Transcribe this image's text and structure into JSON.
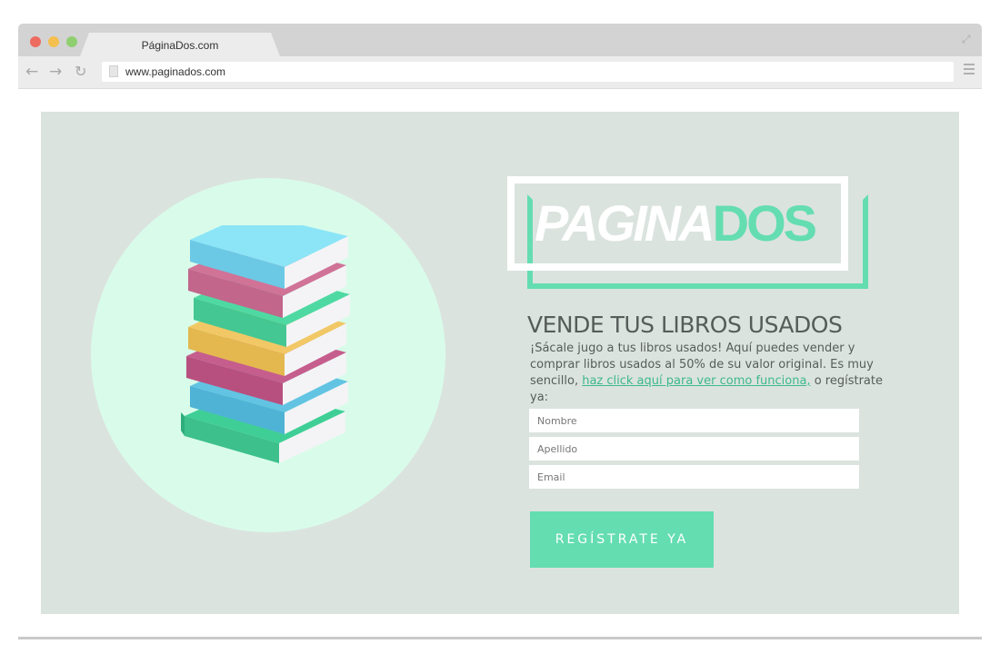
{
  "browser": {
    "tab_title": "PáginaDos.com",
    "url": "www.paginados.com",
    "icons": [
      "back-arrow-icon",
      "forward-arrow-icon",
      "reload-icon",
      "page-icon",
      "menu-icon",
      "expand-icon"
    ]
  },
  "logo": {
    "part_a": "PAGINA",
    "part_b": "DOS"
  },
  "hero": {
    "headline": "VENDE TUS LIBROS USADOS",
    "desc_before": "¡Sácale jugo a tus libros usados! Aquí puedes vender y comprar libros usados al 50% de su valor original. Es muy sencillo, ",
    "desc_link": "haz click aquí para ver como funciona,",
    "desc_after": " o regístrate ya:"
  },
  "form": {
    "nombre_placeholder": "Nombre",
    "apellido_placeholder": "Apellido",
    "email_placeholder": "Email",
    "submit_label": "REGÍSTRATE YA"
  },
  "colors": {
    "accent": "#64ddb1",
    "hero_bg": "#dbe3df",
    "circle_bg": "#d9fcea",
    "text": "#565c5a"
  }
}
